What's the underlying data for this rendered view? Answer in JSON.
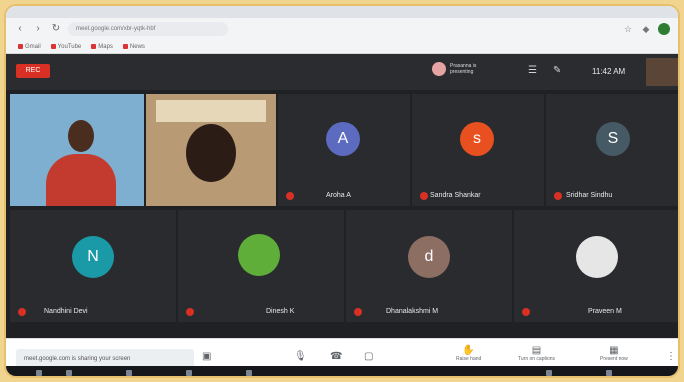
{
  "browser": {
    "url": "meet.google.com/xbr-yqtk-hbf",
    "bookmarks": [
      "Gmail",
      "YouTube",
      "Maps",
      "News"
    ]
  },
  "meeting": {
    "rec_label": "REC",
    "presenter_label": "Prasanna is presenting",
    "clock": "11:42 AM"
  },
  "participants": [
    {
      "id": "p1",
      "kind": "video",
      "name": ""
    },
    {
      "id": "p2",
      "kind": "video",
      "name": ""
    },
    {
      "id": "p3",
      "kind": "avatar",
      "letter": "A",
      "color": "#5c6bc0",
      "name": "Aroha A"
    },
    {
      "id": "p4",
      "kind": "avatar",
      "letter": "s",
      "color": "#e8501f",
      "name": "Sandra Shankar"
    },
    {
      "id": "p5",
      "kind": "avatar",
      "letter": "S",
      "color": "#455a64",
      "name": "Sridhar Sindhu"
    },
    {
      "id": "p6",
      "kind": "avatar",
      "letter": "N",
      "color": "#1a9aa6",
      "name": "Nandhini Devi"
    },
    {
      "id": "p7",
      "kind": "image",
      "name": "Dinesh K"
    },
    {
      "id": "p8",
      "kind": "avatar",
      "letter": "d",
      "color": "#8d6e63",
      "name": "Dhanalakshmi M"
    },
    {
      "id": "p9",
      "kind": "image2",
      "name": "Praveen M"
    }
  ],
  "bottom": {
    "share_note": "meet.google.com is sharing your screen",
    "controls": [
      "Raise hand",
      "Turn on captions",
      "Present now"
    ]
  },
  "colors": {
    "accent": "#d93025",
    "meet_bg": "#202124"
  }
}
